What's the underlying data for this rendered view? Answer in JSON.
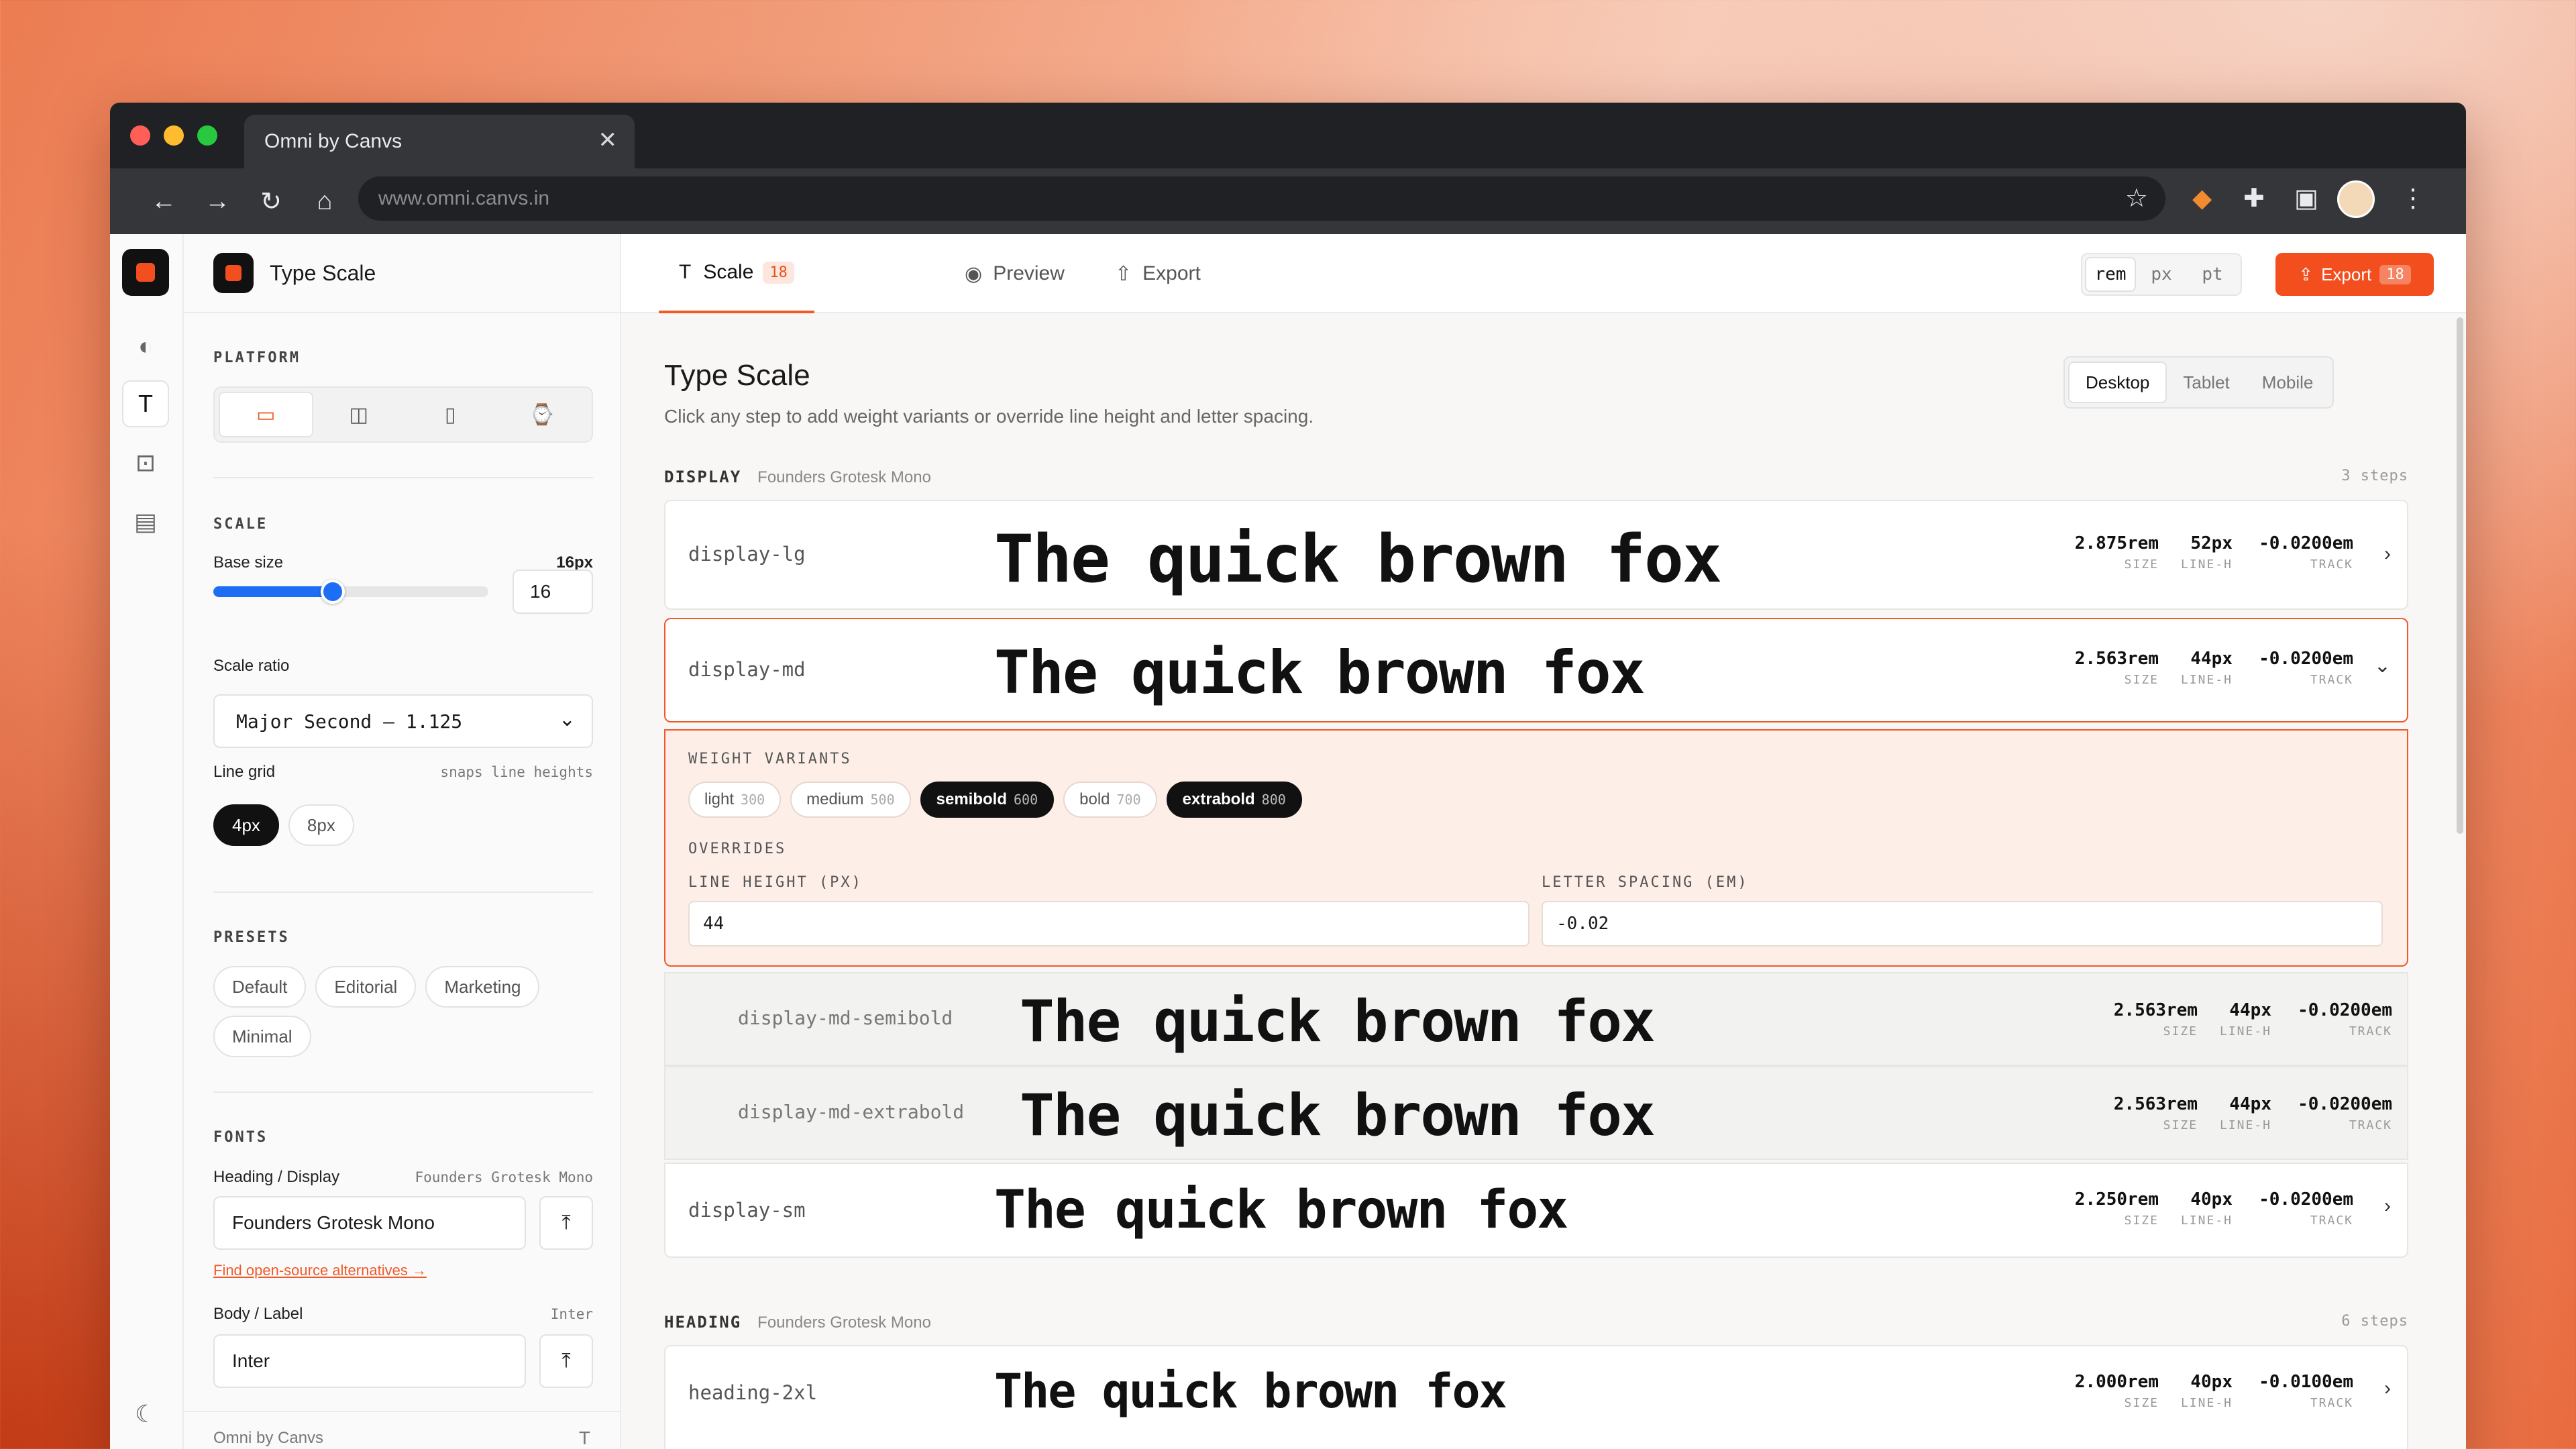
{
  "browser": {
    "tab_title": "Omni by Canvs",
    "close_glyph": "✕",
    "url": "www.omni.canvs.in"
  },
  "sidebar": {
    "title": "Type Scale",
    "platform_label": "PLATFORM",
    "scale_label": "SCALE",
    "base_size_label": "Base size",
    "base_size_value": "16px",
    "base_size_input": "16",
    "base_size_fraction": 0.43,
    "scale_ratio_label": "Scale ratio",
    "scale_ratio_value": "Major Second — 1.125",
    "line_grid_label": "Line grid",
    "line_grid_hint": "snaps line heights",
    "line_grid_options": [
      "4px",
      "8px"
    ],
    "presets_label": "PRESETS",
    "presets": [
      "Default",
      "Editorial",
      "Marketing",
      "Minimal"
    ],
    "fonts_label": "FONTS",
    "heading_label": "Heading / Display",
    "heading_font_hint": "Founders Grotesk Mono",
    "heading_font_value": "Founders Grotesk Mono",
    "alternatives_link": "Find open-source alternatives →",
    "body_label": "Body / Label",
    "body_font_hint": "Inter",
    "body_font_value": "Inter",
    "footer_brand": "Omni by Canvs"
  },
  "topbar": {
    "tabs": [
      {
        "label": "Scale",
        "badge": "18"
      },
      {
        "label": "Preview"
      },
      {
        "label": "Export"
      }
    ],
    "units": [
      "rem",
      "px",
      "pt"
    ],
    "export_label": "Export",
    "export_badge": "18"
  },
  "main": {
    "title": "Type Scale",
    "subtitle": "Click any step to add weight variants or override line height and letter spacing.",
    "devices": [
      "Desktop",
      "Tablet",
      "Mobile"
    ],
    "sample_text": "The quick brown fox",
    "metric_keys": [
      "SIZE",
      "LINE-H",
      "TRACK"
    ],
    "groups": [
      {
        "name": "DISPLAY",
        "font": "Founders Grotesk Mono",
        "count": "3 steps"
      },
      {
        "name": "HEADING",
        "font": "Founders Grotesk Mono",
        "count": "6 steps"
      }
    ],
    "steps": [
      {
        "token": "display-lg",
        "size": "2.875rem",
        "line": "52px",
        "track": "-0.0200em"
      },
      {
        "token": "display-md",
        "size": "2.563rem",
        "line": "44px",
        "track": "-0.0200em"
      },
      {
        "token": "display-md-semibold",
        "size": "2.563rem",
        "line": "44px",
        "track": "-0.0200em"
      },
      {
        "token": "display-md-extrabold",
        "size": "2.563rem",
        "line": "44px",
        "track": "-0.0200em"
      },
      {
        "token": "display-sm",
        "size": "2.250rem",
        "line": "40px",
        "track": "-0.0200em"
      },
      {
        "token": "heading-2xl",
        "size": "2.000rem",
        "line": "40px",
        "track": "-0.0100em"
      }
    ],
    "panel": {
      "weight_label": "WEIGHT VARIANTS",
      "weights": [
        {
          "name": "light",
          "value": "300"
        },
        {
          "name": "medium",
          "value": "500"
        },
        {
          "name": "semibold",
          "value": "600"
        },
        {
          "name": "bold",
          "value": "700"
        },
        {
          "name": "extrabold",
          "value": "800"
        }
      ],
      "overrides_label": "OVERRIDES",
      "line_height_label": "LINE HEIGHT (PX)",
      "line_height_value": "44",
      "letter_spacing_label": "LETTER SPACING (EM)",
      "letter_spacing_value": "-0.02"
    }
  },
  "colors": {
    "accent": "#f24e1e",
    "slider": "#1d6ef5",
    "panel_bg": "#fdeee8"
  }
}
